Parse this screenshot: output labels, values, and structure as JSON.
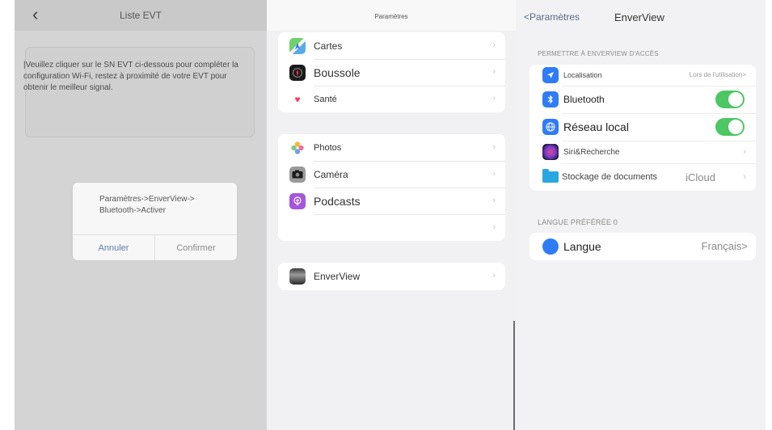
{
  "left_panel": {
    "title": "Liste EVT",
    "back_glyph": "‹",
    "instructions": "|Veuillez cliquer sur le SN EVT ci-dessous pour compléter la configuration Wi-Fi, restez à proximité de votre EVT pour obtenir le meilleur signal.",
    "dialog": {
      "message": "Paramètres->EnverView-> Bluetooth->Activer",
      "cancel_label": "Annuler",
      "confirm_label": "Confirmer"
    }
  },
  "middle_panel": {
    "title": "Paramètres",
    "group1": [
      {
        "label": "Cartes",
        "icon": "maps-icon"
      },
      {
        "label": "Boussole",
        "icon": "compass-icon"
      },
      {
        "label": "Santé",
        "icon": "health-icon"
      }
    ],
    "group2": [
      {
        "label": "Photos",
        "icon": "photos-icon"
      },
      {
        "label": "Caméra",
        "icon": "camera-icon"
      },
      {
        "label": "Podcasts",
        "icon": "podcasts-icon"
      },
      {
        "label": "",
        "icon": ""
      }
    ],
    "group3": [
      {
        "label": "EnverView",
        "icon": "enverview-icon"
      }
    ],
    "chevron": "›"
  },
  "right_panel": {
    "back_label": "<Paramètres",
    "title": "EnverView",
    "section_access": "PERMETTRE À ENVERVIEW D'ACCÈS",
    "localisation": {
      "label": "Localisation",
      "value": "Lors de l'utilisation>"
    },
    "bluetooth": {
      "label": "Bluetooth",
      "enabled": true
    },
    "reseau_local": {
      "label": "Réseau local",
      "enabled": true
    },
    "siri": {
      "label": "Siri&Recherche"
    },
    "stockage": {
      "label": "Stockage de documents",
      "value": "iCloud"
    },
    "section_language": "LANGUE PRÉFÉRÉE 0",
    "langue": {
      "label": "Langue",
      "value": "Français>"
    },
    "chevron": "›"
  },
  "colors": {
    "toggle_on": "#4cc764",
    "left_bg": "#d4d4d4",
    "link_blue": "#5b7fb0"
  }
}
